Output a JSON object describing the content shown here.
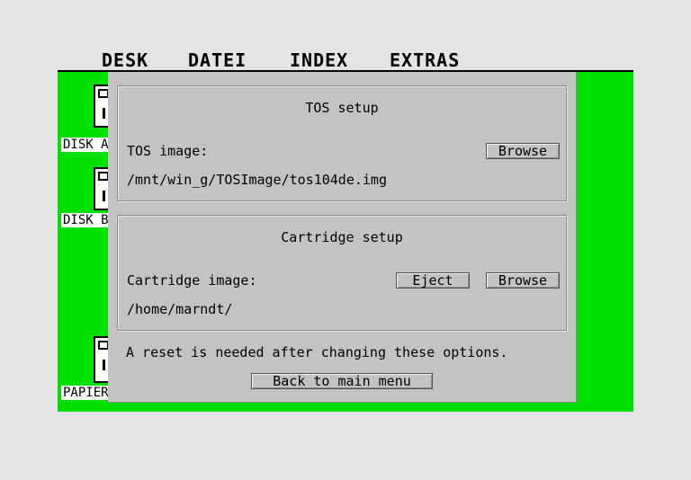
{
  "menubar": {
    "items": [
      {
        "label": "DESK"
      },
      {
        "label": "DATEI"
      },
      {
        "label": "INDEX"
      },
      {
        "label": "EXTRAS"
      }
    ]
  },
  "desktop": {
    "icons": [
      {
        "label": "DISK A"
      },
      {
        "label": "DISK B"
      },
      {
        "label": "PAPIERKORB"
      }
    ],
    "color": "#00e000"
  },
  "dialog": {
    "tos": {
      "title": "TOS setup",
      "image_label": "TOS image:",
      "browse_label": "Browse",
      "path": "/mnt/win_g/TOSImage/tos104de.img"
    },
    "cartridge": {
      "title": "Cartridge setup",
      "image_label": "Cartridge image:",
      "eject_label": "Eject",
      "browse_label": "Browse",
      "path": "/home/marndt/"
    },
    "note": "A reset is needed after changing these options.",
    "back_label": "Back to main menu"
  }
}
